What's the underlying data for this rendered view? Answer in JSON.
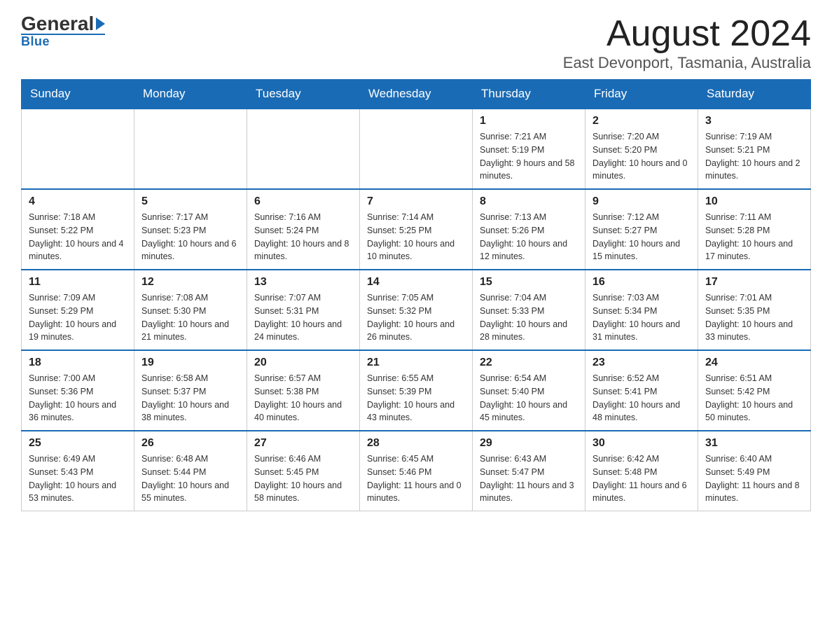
{
  "header": {
    "logo_general": "General",
    "logo_blue": "Blue",
    "main_title": "August 2024",
    "subtitle": "East Devonport, Tasmania, Australia"
  },
  "calendar": {
    "days_of_week": [
      "Sunday",
      "Monday",
      "Tuesday",
      "Wednesday",
      "Thursday",
      "Friday",
      "Saturday"
    ],
    "weeks": [
      {
        "days": [
          {
            "number": "",
            "info": ""
          },
          {
            "number": "",
            "info": ""
          },
          {
            "number": "",
            "info": ""
          },
          {
            "number": "",
            "info": ""
          },
          {
            "number": "1",
            "info": "Sunrise: 7:21 AM\nSunset: 5:19 PM\nDaylight: 9 hours\nand 58 minutes."
          },
          {
            "number": "2",
            "info": "Sunrise: 7:20 AM\nSunset: 5:20 PM\nDaylight: 10 hours\nand 0 minutes."
          },
          {
            "number": "3",
            "info": "Sunrise: 7:19 AM\nSunset: 5:21 PM\nDaylight: 10 hours\nand 2 minutes."
          }
        ]
      },
      {
        "days": [
          {
            "number": "4",
            "info": "Sunrise: 7:18 AM\nSunset: 5:22 PM\nDaylight: 10 hours\nand 4 minutes."
          },
          {
            "number": "5",
            "info": "Sunrise: 7:17 AM\nSunset: 5:23 PM\nDaylight: 10 hours\nand 6 minutes."
          },
          {
            "number": "6",
            "info": "Sunrise: 7:16 AM\nSunset: 5:24 PM\nDaylight: 10 hours\nand 8 minutes."
          },
          {
            "number": "7",
            "info": "Sunrise: 7:14 AM\nSunset: 5:25 PM\nDaylight: 10 hours\nand 10 minutes."
          },
          {
            "number": "8",
            "info": "Sunrise: 7:13 AM\nSunset: 5:26 PM\nDaylight: 10 hours\nand 12 minutes."
          },
          {
            "number": "9",
            "info": "Sunrise: 7:12 AM\nSunset: 5:27 PM\nDaylight: 10 hours\nand 15 minutes."
          },
          {
            "number": "10",
            "info": "Sunrise: 7:11 AM\nSunset: 5:28 PM\nDaylight: 10 hours\nand 17 minutes."
          }
        ]
      },
      {
        "days": [
          {
            "number": "11",
            "info": "Sunrise: 7:09 AM\nSunset: 5:29 PM\nDaylight: 10 hours\nand 19 minutes."
          },
          {
            "number": "12",
            "info": "Sunrise: 7:08 AM\nSunset: 5:30 PM\nDaylight: 10 hours\nand 21 minutes."
          },
          {
            "number": "13",
            "info": "Sunrise: 7:07 AM\nSunset: 5:31 PM\nDaylight: 10 hours\nand 24 minutes."
          },
          {
            "number": "14",
            "info": "Sunrise: 7:05 AM\nSunset: 5:32 PM\nDaylight: 10 hours\nand 26 minutes."
          },
          {
            "number": "15",
            "info": "Sunrise: 7:04 AM\nSunset: 5:33 PM\nDaylight: 10 hours\nand 28 minutes."
          },
          {
            "number": "16",
            "info": "Sunrise: 7:03 AM\nSunset: 5:34 PM\nDaylight: 10 hours\nand 31 minutes."
          },
          {
            "number": "17",
            "info": "Sunrise: 7:01 AM\nSunset: 5:35 PM\nDaylight: 10 hours\nand 33 minutes."
          }
        ]
      },
      {
        "days": [
          {
            "number": "18",
            "info": "Sunrise: 7:00 AM\nSunset: 5:36 PM\nDaylight: 10 hours\nand 36 minutes."
          },
          {
            "number": "19",
            "info": "Sunrise: 6:58 AM\nSunset: 5:37 PM\nDaylight: 10 hours\nand 38 minutes."
          },
          {
            "number": "20",
            "info": "Sunrise: 6:57 AM\nSunset: 5:38 PM\nDaylight: 10 hours\nand 40 minutes."
          },
          {
            "number": "21",
            "info": "Sunrise: 6:55 AM\nSunset: 5:39 PM\nDaylight: 10 hours\nand 43 minutes."
          },
          {
            "number": "22",
            "info": "Sunrise: 6:54 AM\nSunset: 5:40 PM\nDaylight: 10 hours\nand 45 minutes."
          },
          {
            "number": "23",
            "info": "Sunrise: 6:52 AM\nSunset: 5:41 PM\nDaylight: 10 hours\nand 48 minutes."
          },
          {
            "number": "24",
            "info": "Sunrise: 6:51 AM\nSunset: 5:42 PM\nDaylight: 10 hours\nand 50 minutes."
          }
        ]
      },
      {
        "days": [
          {
            "number": "25",
            "info": "Sunrise: 6:49 AM\nSunset: 5:43 PM\nDaylight: 10 hours\nand 53 minutes."
          },
          {
            "number": "26",
            "info": "Sunrise: 6:48 AM\nSunset: 5:44 PM\nDaylight: 10 hours\nand 55 minutes."
          },
          {
            "number": "27",
            "info": "Sunrise: 6:46 AM\nSunset: 5:45 PM\nDaylight: 10 hours\nand 58 minutes."
          },
          {
            "number": "28",
            "info": "Sunrise: 6:45 AM\nSunset: 5:46 PM\nDaylight: 11 hours\nand 0 minutes."
          },
          {
            "number": "29",
            "info": "Sunrise: 6:43 AM\nSunset: 5:47 PM\nDaylight: 11 hours\nand 3 minutes."
          },
          {
            "number": "30",
            "info": "Sunrise: 6:42 AM\nSunset: 5:48 PM\nDaylight: 11 hours\nand 6 minutes."
          },
          {
            "number": "31",
            "info": "Sunrise: 6:40 AM\nSunset: 5:49 PM\nDaylight: 11 hours\nand 8 minutes."
          }
        ]
      }
    ]
  }
}
